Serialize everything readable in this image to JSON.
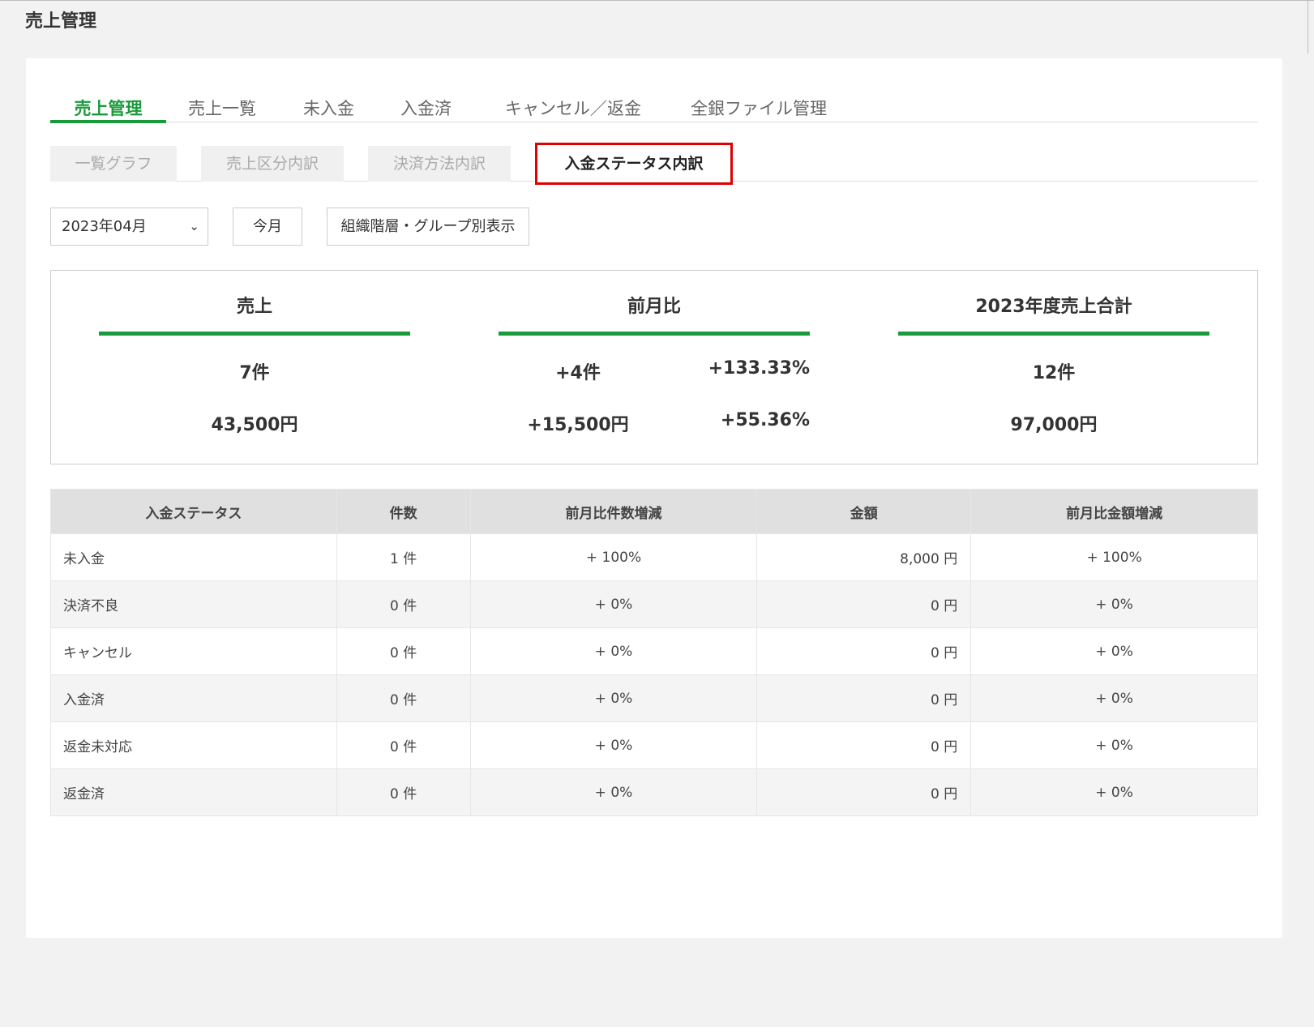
{
  "page_title": "売上管理",
  "main_tabs": [
    {
      "label": "売上管理",
      "active": true
    },
    {
      "label": "売上一覧",
      "active": false
    },
    {
      "label": "未入金",
      "active": false
    },
    {
      "label": "入金済",
      "active": false
    },
    {
      "label": "キャンセル／返金",
      "active": false
    },
    {
      "label": "全銀ファイル管理",
      "active": false
    }
  ],
  "sub_tabs": [
    {
      "label": "一覧グラフ",
      "active": false
    },
    {
      "label": "売上区分内訳",
      "active": false
    },
    {
      "label": "決済方法内訳",
      "active": false
    },
    {
      "label": "入金ステータス内訳",
      "active": true
    }
  ],
  "controls": {
    "month_value": "2023年04月",
    "this_month_label": "今月",
    "group_view_label": "組織階層・グループ別表示"
  },
  "summary": {
    "sales": {
      "title": "売上",
      "count": "7件",
      "amount": "43,500円"
    },
    "mom": {
      "title": "前月比",
      "count_diff": "+4件",
      "count_pct": "+133.33%",
      "amount_diff": "+15,500円",
      "amount_pct": "+55.36%"
    },
    "fiscal": {
      "title": "2023年度売上合計",
      "count": "12件",
      "amount": "97,000円"
    }
  },
  "table": {
    "headers": [
      "入金ステータス",
      "件数",
      "前月比件数増減",
      "金額",
      "前月比金額増減"
    ],
    "rows": [
      [
        "未入金",
        "1 件",
        "+ 100%",
        "8,000 円",
        "+ 100%"
      ],
      [
        "決済不良",
        "0 件",
        "+ 0%",
        "0 円",
        "+ 0%"
      ],
      [
        "キャンセル",
        "0 件",
        "+ 0%",
        "0 円",
        "+ 0%"
      ],
      [
        "入金済",
        "0 件",
        "+ 0%",
        "0 円",
        "+ 0%"
      ],
      [
        "返金未対応",
        "0 件",
        "+ 0%",
        "0 円",
        "+ 0%"
      ],
      [
        "返金済",
        "0 件",
        "+ 0%",
        "0 円",
        "+ 0%"
      ]
    ]
  },
  "colors": {
    "accent": "#1a9a3a",
    "highlight": "#e00000"
  }
}
